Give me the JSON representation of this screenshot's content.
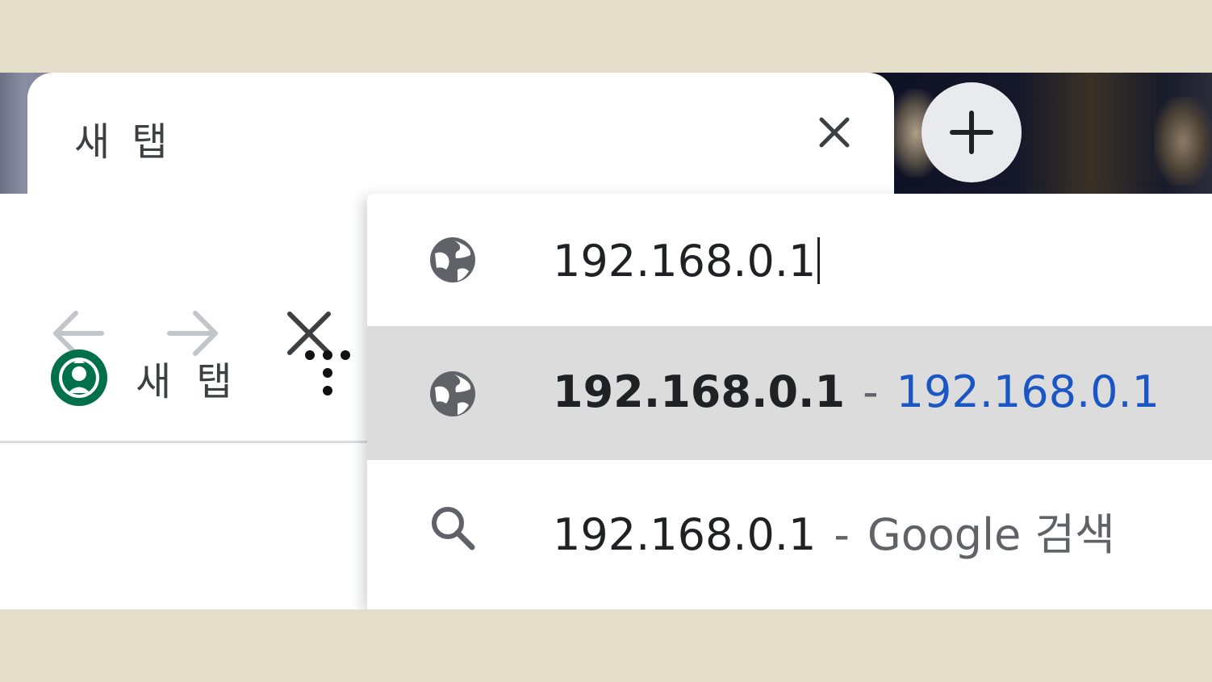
{
  "tab": {
    "title": "새 탭"
  },
  "nav": {
    "back": "back-arrow-icon",
    "forward": "forward-arrow-icon",
    "stop": "close-icon"
  },
  "bookmarks": [
    {
      "label": "새 탭",
      "icon": "starbucks-logo-icon"
    }
  ],
  "omnibox": {
    "input_value": "192.168.0.1"
  },
  "suggestions": [
    {
      "primary": "192.168.0.1",
      "separator": "-",
      "secondary": "192.168.0.1",
      "icon": "globe-icon"
    },
    {
      "primary": "192.168.0.1",
      "separator": "-",
      "secondary": "Google 검색",
      "icon": "search-icon"
    }
  ],
  "colors": {
    "url_blue": "#1a56c4",
    "selected_row": "#dcdcdc",
    "text": "#202124"
  }
}
